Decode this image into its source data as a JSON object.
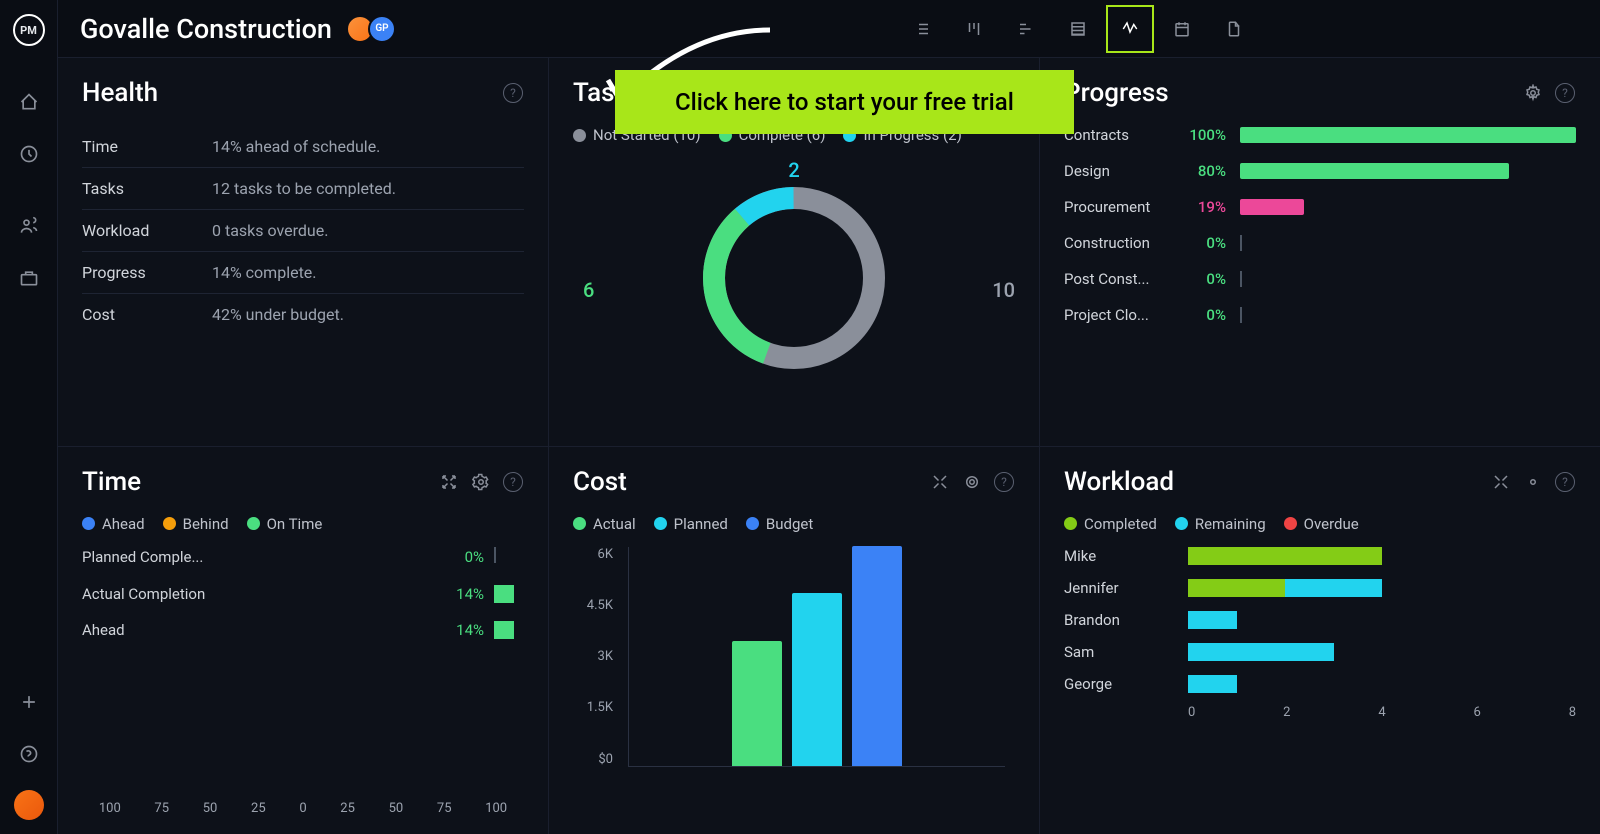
{
  "project": {
    "title": "Govalle Construction",
    "member2_initials": "GP"
  },
  "cta": "Click here to start your free trial",
  "health": {
    "title": "Health",
    "rows": [
      {
        "label": "Time",
        "value": "14% ahead of schedule."
      },
      {
        "label": "Tasks",
        "value": "12 tasks to be completed."
      },
      {
        "label": "Workload",
        "value": "0 tasks overdue."
      },
      {
        "label": "Progress",
        "value": "14% complete."
      },
      {
        "label": "Cost",
        "value": "42% under budget."
      }
    ]
  },
  "tasks": {
    "title": "Tasks",
    "legend": [
      {
        "label": "Not Started (10)",
        "color": "#8a8f9a"
      },
      {
        "label": "Complete (6)",
        "color": "#4ade80"
      },
      {
        "label": "In Progress (2)",
        "color": "#22d3ee"
      }
    ],
    "labels": {
      "not_started": "10",
      "complete": "6",
      "in_progress": "2"
    }
  },
  "progress": {
    "title": "Progress",
    "rows": [
      {
        "name": "Contracts",
        "pct": 100,
        "pct_label": "100%",
        "color": "#4ade80"
      },
      {
        "name": "Design",
        "pct": 80,
        "pct_label": "80%",
        "color": "#4ade80"
      },
      {
        "name": "Procurement",
        "pct": 19,
        "pct_label": "19%",
        "color": "#ec4899"
      },
      {
        "name": "Construction",
        "pct": 0,
        "pct_label": "0%",
        "color": "#4ade80"
      },
      {
        "name": "Post Const...",
        "pct": 0,
        "pct_label": "0%",
        "color": "#4ade80"
      },
      {
        "name": "Project Clo...",
        "pct": 0,
        "pct_label": "0%",
        "color": "#4ade80"
      }
    ]
  },
  "time": {
    "title": "Time",
    "legend": [
      {
        "label": "Ahead",
        "color": "#3b82f6"
      },
      {
        "label": "Behind",
        "color": "#f59e0b"
      },
      {
        "label": "On Time",
        "color": "#4ade80"
      }
    ],
    "rows": [
      {
        "label": "Planned Comple...",
        "val": "0%",
        "bar": 0
      },
      {
        "label": "Actual Completion",
        "val": "14%",
        "bar": 14
      },
      {
        "label": "Ahead",
        "val": "14%",
        "bar": 14
      }
    ],
    "axis": [
      "100",
      "75",
      "50",
      "25",
      "0",
      "25",
      "50",
      "75",
      "100"
    ]
  },
  "cost": {
    "title": "Cost",
    "legend": [
      {
        "label": "Actual",
        "color": "#4ade80"
      },
      {
        "label": "Planned",
        "color": "#22d3ee"
      },
      {
        "label": "Budget",
        "color": "#3b82f6"
      }
    ],
    "yaxis": [
      "6K",
      "4.5K",
      "3K",
      "1.5K",
      "$0"
    ],
    "bars": [
      {
        "value": 3400,
        "color": "#4ade80"
      },
      {
        "value": 4700,
        "color": "#22d3ee"
      },
      {
        "value": 6000,
        "color": "#3b82f6"
      }
    ],
    "max": 6000
  },
  "workload": {
    "title": "Workload",
    "legend": [
      {
        "label": "Completed",
        "color": "#84cc16"
      },
      {
        "label": "Remaining",
        "color": "#22d3ee"
      },
      {
        "label": "Overdue",
        "color": "#ef4444"
      }
    ],
    "max": 8,
    "rows": [
      {
        "name": "Mike",
        "segments": [
          {
            "v": 4,
            "c": "#84cc16"
          }
        ]
      },
      {
        "name": "Jennifer",
        "segments": [
          {
            "v": 2,
            "c": "#84cc16"
          },
          {
            "v": 2,
            "c": "#22d3ee"
          }
        ]
      },
      {
        "name": "Brandon",
        "segments": [
          {
            "v": 1,
            "c": "#22d3ee"
          }
        ]
      },
      {
        "name": "Sam",
        "segments": [
          {
            "v": 3,
            "c": "#22d3ee"
          }
        ]
      },
      {
        "name": "George",
        "segments": [
          {
            "v": 1,
            "c": "#22d3ee"
          }
        ]
      }
    ],
    "axis": [
      "0",
      "2",
      "4",
      "6",
      "8"
    ]
  },
  "chart_data": [
    {
      "type": "pie",
      "title": "Tasks",
      "series": [
        {
          "name": "Not Started",
          "value": 10
        },
        {
          "name": "Complete",
          "value": 6
        },
        {
          "name": "In Progress",
          "value": 2
        }
      ]
    },
    {
      "type": "bar",
      "title": "Progress",
      "categories": [
        "Contracts",
        "Design",
        "Procurement",
        "Construction",
        "Post Construction",
        "Project Closure"
      ],
      "values": [
        100,
        80,
        19,
        0,
        0,
        0
      ],
      "ylabel": "%",
      "ylim": [
        0,
        100
      ]
    },
    {
      "type": "bar",
      "title": "Cost",
      "categories": [
        "Actual",
        "Planned",
        "Budget"
      ],
      "values": [
        3400,
        4700,
        6000
      ],
      "ylabel": "$",
      "ylim": [
        0,
        6000
      ]
    },
    {
      "type": "bar",
      "title": "Workload",
      "categories": [
        "Mike",
        "Jennifer",
        "Brandon",
        "Sam",
        "George"
      ],
      "series": [
        {
          "name": "Completed",
          "values": [
            4,
            2,
            0,
            0,
            0
          ]
        },
        {
          "name": "Remaining",
          "values": [
            0,
            2,
            1,
            3,
            1
          ]
        },
        {
          "name": "Overdue",
          "values": [
            0,
            0,
            0,
            0,
            0
          ]
        }
      ],
      "xlim": [
        0,
        8
      ]
    },
    {
      "type": "bar",
      "title": "Time",
      "categories": [
        "Planned Completion",
        "Actual Completion",
        "Ahead"
      ],
      "values": [
        0,
        14,
        14
      ],
      "ylabel": "%",
      "ylim": [
        -100,
        100
      ]
    }
  ]
}
